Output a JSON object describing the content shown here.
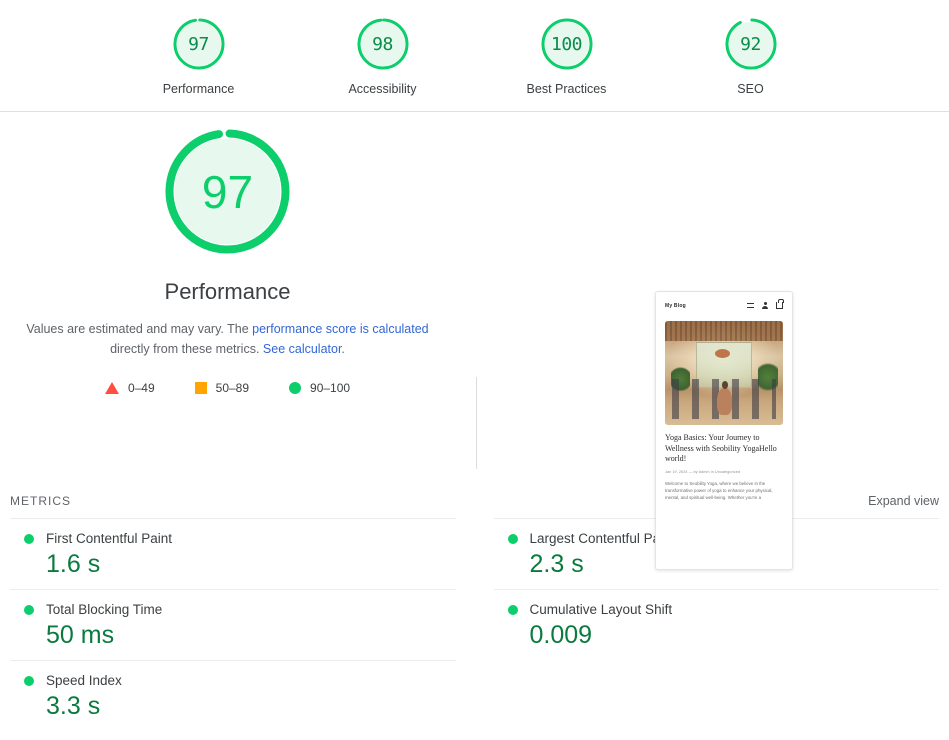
{
  "category_gauges": [
    {
      "score": "97",
      "label": "Performance",
      "pct": 97,
      "icon": "score-gauge-icon"
    },
    {
      "score": "98",
      "label": "Accessibility",
      "pct": 98,
      "icon": "score-gauge-icon"
    },
    {
      "score": "100",
      "label": "Best Practices",
      "pct": 100,
      "icon": "score-gauge-icon"
    },
    {
      "score": "92",
      "label": "SEO",
      "pct": 92,
      "icon": "score-gauge-icon"
    }
  ],
  "hero": {
    "score": "97",
    "title": "Performance",
    "desc_part1": "Values are estimated and may vary. The ",
    "desc_link1": "performance score is calculated",
    "desc_part2": " directly from these metrics. ",
    "desc_link2": "See calculator.",
    "legend": [
      {
        "marker": "triangle-marker",
        "range": "0–49",
        "color": "#ff4e42"
      },
      {
        "marker": "square-marker",
        "range": "50–89",
        "color": "#ffa400"
      },
      {
        "marker": "circle-marker",
        "range": "90–100",
        "color": "#0cce6b"
      }
    ]
  },
  "thumbnail": {
    "brand": "My Blog",
    "icons": [
      "menu-icon",
      "account-icon",
      "cart-icon"
    ],
    "article_title": "Yoga Basics: Your Journey to Wellness with Seobility YogaHello world!",
    "article_meta": "Jan 19, 2024 — by Admin in Uncategorized",
    "article_body": "Welcome to Seobility Yoga, where we believe in the transformative power of yoga to enhance your physical, mental, and spiritual well-being. Whether you're a"
  },
  "metrics": {
    "title": "METRICS",
    "expand_label": "Expand view",
    "left": [
      {
        "name": "First Contentful Paint",
        "value": "1.6 s",
        "status": "pass"
      },
      {
        "name": "Total Blocking Time",
        "value": "50 ms",
        "status": "pass"
      },
      {
        "name": "Speed Index",
        "value": "3.3 s",
        "status": "pass"
      }
    ],
    "right": [
      {
        "name": "Largest Contentful Paint",
        "value": "2.3 s",
        "status": "pass"
      },
      {
        "name": "Cumulative Layout Shift",
        "value": "0.009",
        "status": "pass"
      }
    ]
  },
  "colors": {
    "pass_green": "#0cce6b",
    "value_green": "#0a7b3e",
    "average_orange": "#ffa400",
    "fail_red": "#ff4e42",
    "link_blue": "#3367d6"
  }
}
